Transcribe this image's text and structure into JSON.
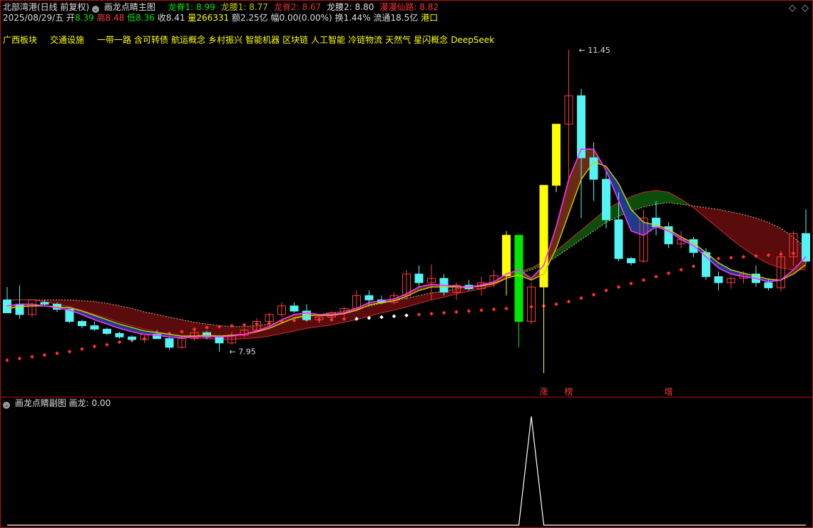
{
  "header": {
    "stock_name": "北部湾港(日线 前复权)",
    "main_indicator": "画龙点睛主图",
    "pills": [
      {
        "label": "龙脊1: 8.99",
        "color": "#00e600"
      },
      {
        "label": "龙腰1: 8.77",
        "color": "#c8c800"
      },
      {
        "label": "龙脊2: 8.67",
        "color": "#e23030"
      },
      {
        "label": "龙腰2: 8.80",
        "color": "#dddddd"
      },
      {
        "label": "漫漫仙路: 8.82",
        "color": "#ff3030"
      }
    ],
    "date": "2025/08/29/五",
    "open_label": "开",
    "open": "8.39",
    "high_label": "高",
    "high": "8.48",
    "low_label": "低",
    "low": "8.36",
    "close_label": "收",
    "close": "8.41",
    "vol_label": "量",
    "vol": "266331",
    "amount_text": "额2.25亿",
    "amp_text": "幅0.00(0.00%)",
    "turnover_text": "换1.44%",
    "float_text": "流通18.5亿",
    "region": "港口"
  },
  "concepts": [
    "广西板块",
    "交通设施",
    "一带一路",
    "含可转债",
    "航运概念",
    "乡村振兴",
    "智能机器",
    "区块链",
    "人工智能",
    "冷链物流",
    "天然气",
    "星闪概念",
    "DeepSeek"
  ],
  "sub_panel": {
    "title": "画龙点睛副图",
    "series_label": "画龙: 0.00"
  },
  "chart_data": [
    {
      "type": "candlestick",
      "title": "画龙点睛主图",
      "candles": [
        [
          8.55,
          8.7,
          8.5,
          8.4
        ],
        [
          8.5,
          8.72,
          8.33,
          8.38
        ],
        [
          8.38,
          8.52,
          8.35,
          8.55
        ],
        [
          8.52,
          8.55,
          8.48,
          8.5
        ],
        [
          8.5,
          8.52,
          8.41,
          8.44
        ],
        [
          8.44,
          8.45,
          8.28,
          8.3
        ],
        [
          8.3,
          8.32,
          8.22,
          8.25
        ],
        [
          8.25,
          8.3,
          8.19,
          8.21
        ],
        [
          8.21,
          8.23,
          8.14,
          8.16
        ],
        [
          8.16,
          8.18,
          8.1,
          8.12
        ],
        [
          8.12,
          8.14,
          8.07,
          8.09
        ],
        [
          8.09,
          8.14,
          8.05,
          8.15
        ],
        [
          8.15,
          8.2,
          8.13,
          8.1
        ],
        [
          8.1,
          8.12,
          7.97,
          8.0
        ],
        [
          8.0,
          8.13,
          7.98,
          8.1
        ],
        [
          8.1,
          8.2,
          8.08,
          8.17
        ],
        [
          8.17,
          8.19,
          8.09,
          8.12
        ],
        [
          8.12,
          8.14,
          7.95,
          8.05
        ],
        [
          8.05,
          8.18,
          8.03,
          8.14
        ],
        [
          8.14,
          8.22,
          8.12,
          8.2
        ],
        [
          8.2,
          8.34,
          8.18,
          8.3
        ],
        [
          8.3,
          8.4,
          8.25,
          8.38
        ],
        [
          8.38,
          8.52,
          8.35,
          8.48
        ],
        [
          8.48,
          8.52,
          8.4,
          8.42
        ],
        [
          8.42,
          8.5,
          8.3,
          8.32
        ],
        [
          8.32,
          8.38,
          8.28,
          8.35
        ],
        [
          8.35,
          8.42,
          8.3,
          8.4
        ],
        [
          8.4,
          8.47,
          8.36,
          8.45
        ],
        [
          8.45,
          8.66,
          8.42,
          8.6
        ],
        [
          8.6,
          8.66,
          8.5,
          8.55
        ],
        [
          8.55,
          8.6,
          8.5,
          8.52
        ],
        [
          8.52,
          8.64,
          8.5,
          8.6
        ],
        [
          8.6,
          8.9,
          8.55,
          8.85
        ],
        [
          8.85,
          8.95,
          8.7,
          8.75
        ],
        [
          8.75,
          8.96,
          8.55,
          8.8
        ],
        [
          8.8,
          8.85,
          8.6,
          8.64
        ],
        [
          8.64,
          8.75,
          8.55,
          8.72
        ],
        [
          8.72,
          8.78,
          8.66,
          8.68
        ],
        [
          8.68,
          8.82,
          8.6,
          8.75
        ],
        [
          8.75,
          8.9,
          8.7,
          8.83
        ],
        [
          8.83,
          9.35,
          8.6,
          9.3
        ],
        [
          9.3,
          9.3,
          8.0,
          8.3
        ],
        [
          8.3,
          8.75,
          8.27,
          8.7
        ],
        [
          8.7,
          9.88,
          7.7,
          9.88
        ],
        [
          9.88,
          10.59,
          9.8,
          10.59
        ],
        [
          10.59,
          11.45,
          9.95,
          10.92
        ],
        [
          10.92,
          11.0,
          9.5,
          10.2
        ],
        [
          10.2,
          10.38,
          9.7,
          9.95
        ],
        [
          9.95,
          10.05,
          9.38,
          9.48
        ],
        [
          9.48,
          9.8,
          9.0,
          9.03
        ],
        [
          9.03,
          9.05,
          8.95,
          8.98
        ],
        [
          9.0,
          9.6,
          8.98,
          9.5
        ],
        [
          9.5,
          9.7,
          9.3,
          9.4
        ],
        [
          9.4,
          9.45,
          9.15,
          9.2
        ],
        [
          9.2,
          9.35,
          9.15,
          9.25
        ],
        [
          9.25,
          9.28,
          9.05,
          9.1
        ],
        [
          9.1,
          9.15,
          8.78,
          8.82
        ],
        [
          8.82,
          8.88,
          8.66,
          8.75
        ],
        [
          8.75,
          8.82,
          8.68,
          8.8
        ],
        [
          8.8,
          8.88,
          8.74,
          8.85
        ],
        [
          8.85,
          8.95,
          8.7,
          8.75
        ],
        [
          8.75,
          8.8,
          8.66,
          8.69
        ],
        [
          8.69,
          9.12,
          8.65,
          9.05
        ],
        [
          9.05,
          9.35,
          8.95,
          9.32
        ],
        [
          9.32,
          9.6,
          8.97,
          9.0
        ]
      ],
      "limit_up_days": [
        40,
        43,
        44
      ],
      "limit_down_days": [
        41
      ],
      "ma_fast": [
        8.48,
        8.5,
        8.5,
        8.48,
        8.46,
        8.43,
        8.38,
        8.32,
        8.27,
        8.22,
        8.18,
        8.15,
        8.14,
        8.12,
        8.11,
        8.12,
        8.13,
        8.12,
        8.13,
        8.15,
        8.19,
        8.24,
        8.32,
        8.38,
        8.4,
        8.38,
        8.38,
        8.4,
        8.45,
        8.52,
        8.54,
        8.56,
        8.62,
        8.7,
        8.73,
        8.72,
        8.71,
        8.7,
        8.72,
        8.76,
        8.85,
        8.9,
        8.8,
        8.95,
        9.4,
        9.95,
        10.3,
        10.3,
        10.05,
        9.7,
        9.35,
        9.3,
        9.4,
        9.35,
        9.25,
        9.18,
        9.05,
        8.92,
        8.85,
        8.82,
        8.8,
        8.76,
        8.78,
        8.9,
        9.05
      ],
      "ma_slow": [
        8.45,
        8.47,
        8.48,
        8.48,
        8.47,
        8.46,
        8.42,
        8.37,
        8.32,
        8.27,
        8.23,
        8.19,
        8.17,
        8.15,
        8.13,
        8.13,
        8.14,
        8.13,
        8.14,
        8.15,
        8.18,
        8.22,
        8.28,
        8.34,
        8.37,
        8.37,
        8.37,
        8.39,
        8.43,
        8.49,
        8.52,
        8.54,
        8.59,
        8.66,
        8.7,
        8.7,
        8.7,
        8.7,
        8.71,
        8.74,
        8.8,
        8.84,
        8.78,
        8.85,
        9.15,
        9.55,
        9.95,
        10.15,
        10.1,
        9.9,
        9.6,
        9.45,
        9.42,
        9.37,
        9.28,
        9.21,
        9.1,
        8.98,
        8.9,
        8.86,
        8.83,
        8.79,
        8.78,
        8.85,
        8.96
      ],
      "cloud_upper": [
        8.55,
        8.55,
        8.55,
        8.55,
        8.55,
        8.55,
        8.54,
        8.53,
        8.51,
        8.48,
        8.45,
        8.41,
        8.38,
        8.35,
        8.32,
        8.29,
        8.27,
        8.25,
        8.24,
        8.24,
        8.25,
        8.27,
        8.3,
        8.33,
        8.36,
        8.38,
        8.4,
        8.42,
        8.45,
        8.48,
        8.51,
        8.54,
        8.57,
        8.6,
        8.63,
        8.65,
        8.68,
        8.7,
        8.73,
        8.76,
        8.8,
        8.85,
        8.9,
        8.96,
        9.05,
        9.15,
        9.25,
        9.35,
        9.45,
        9.52,
        9.58,
        9.63,
        9.66,
        9.68,
        9.66,
        9.64,
        9.62,
        9.6,
        9.57,
        9.54,
        9.5,
        9.45,
        9.38,
        9.28,
        9.15
      ],
      "cloud_lower": [
        8.55,
        8.55,
        8.55,
        8.53,
        8.5,
        8.47,
        8.43,
        8.38,
        8.34,
        8.29,
        8.25,
        8.21,
        8.18,
        8.15,
        8.13,
        8.11,
        8.1,
        8.09,
        8.09,
        8.1,
        8.11,
        8.13,
        8.16,
        8.19,
        8.22,
        8.24,
        8.26,
        8.29,
        8.32,
        8.36,
        8.4,
        8.43,
        8.47,
        8.51,
        8.55,
        8.58,
        8.62,
        8.65,
        8.68,
        8.72,
        8.8,
        8.88,
        8.92,
        9.0,
        9.12,
        9.24,
        9.36,
        9.48,
        9.6,
        9.68,
        9.75,
        9.8,
        9.82,
        9.8,
        9.72,
        9.62,
        9.5,
        9.38,
        9.26,
        9.15,
        9.05,
        8.97,
        8.92,
        8.9,
        8.9
      ],
      "stop_dots": [
        7.85,
        7.87,
        7.89,
        7.91,
        7.93,
        7.95,
        7.98,
        8.01,
        8.03,
        8.06,
        8.08,
        8.1,
        8.13,
        8.16,
        8.18,
        8.21,
        8.23,
        8.24,
        8.25,
        8.26,
        8.27,
        8.28,
        8.3,
        8.31,
        8.32,
        8.32,
        8.32,
        8.33,
        8.33,
        8.34,
        8.35,
        8.36,
        8.37,
        8.38,
        8.39,
        8.4,
        8.41,
        8.42,
        8.43,
        8.44,
        8.45,
        8.46,
        8.47,
        8.48,
        8.5,
        8.53,
        8.57,
        8.61,
        8.66,
        8.7,
        8.74,
        8.78,
        8.82,
        8.86,
        8.9,
        8.94,
        9.02,
        9.03,
        9.04,
        9.05,
        9.06,
        9.07,
        9.08,
        9.09,
        9.1
      ],
      "white_dot_days": [
        28,
        29,
        30,
        31,
        32
      ],
      "annotations": [
        {
          "text": "11.45",
          "day": 45,
          "price": 11.45
        },
        {
          "text": "7.95",
          "day": 17,
          "price": 7.95
        }
      ],
      "markers": [
        {
          "text": "涨",
          "day": 43
        },
        {
          "text": "榜",
          "day": 45
        },
        {
          "text": "增",
          "day": 53
        }
      ],
      "colors": {
        "up": "#ff3b3b",
        "down": "#54f4f4",
        "limit_up": "#ffff00",
        "limit_down": "#00e600",
        "ma_fast": "#ff30ff",
        "ma_slow": "#d0d000",
        "cloud_bull": "#5a0c0c",
        "cloud_bear": "#0b4d0b",
        "gap_blue": "#1c3c8c",
        "dots": "#ff3030",
        "white_dots": "#ffffff"
      },
      "ylim": [
        7.6,
        11.7
      ]
    },
    {
      "type": "line",
      "title": "画龙点睛副图",
      "series": [
        {
          "name": "画龙",
          "values": [
            0,
            0,
            0,
            0,
            0,
            0,
            0,
            0,
            0,
            0,
            0,
            0,
            0,
            0,
            0,
            0,
            0,
            0,
            0,
            0,
            0,
            0,
            0,
            0,
            0,
            0,
            0,
            0,
            0,
            0,
            0,
            0,
            0,
            0,
            0,
            0,
            0,
            0,
            0,
            0,
            0,
            0,
            1,
            0,
            0,
            0,
            0,
            0,
            0,
            0,
            0,
            0,
            0,
            0,
            0,
            0,
            0,
            0,
            0,
            0,
            0,
            0,
            0,
            0,
            0
          ]
        }
      ],
      "ylim": [
        0,
        1.05
      ],
      "color": "#ffffff"
    }
  ]
}
